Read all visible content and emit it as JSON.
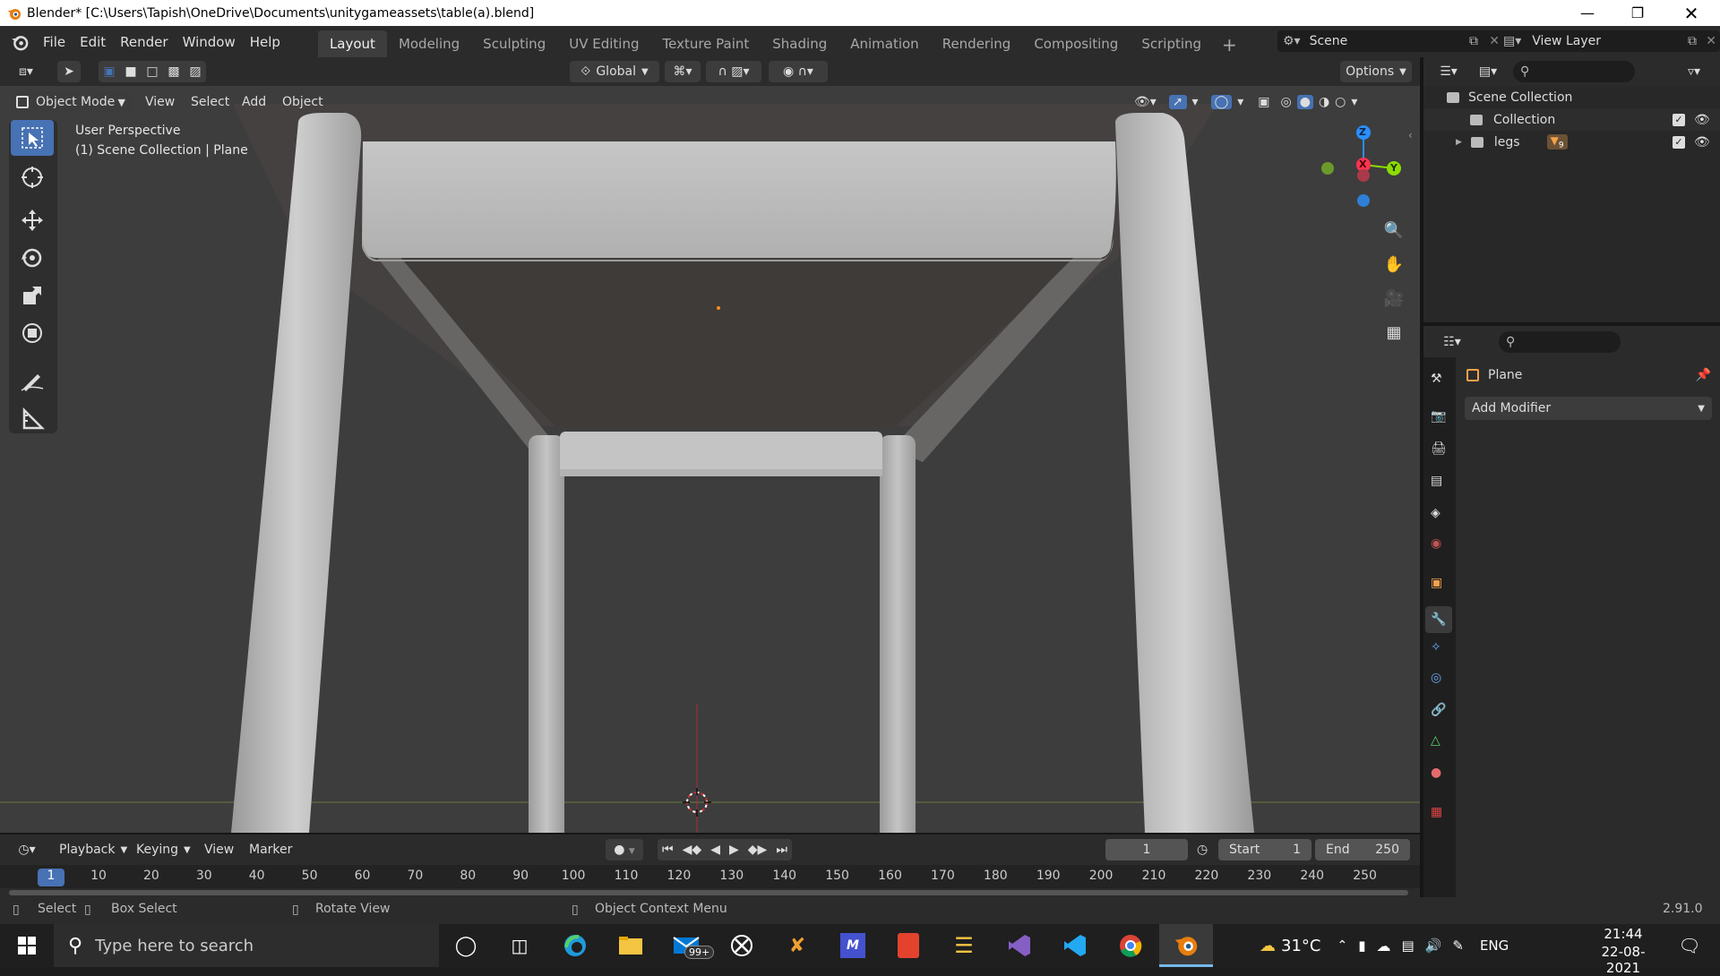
{
  "window": {
    "title": "Blender* [C:\\Users\\Tapish\\OneDrive\\Documents\\unitygameassets\\table(a).blend]"
  },
  "menu": [
    "File",
    "Edit",
    "Render",
    "Window",
    "Help"
  ],
  "workspaces": [
    "Layout",
    "Modeling",
    "Sculpting",
    "UV Editing",
    "Texture Paint",
    "Shading",
    "Animation",
    "Rendering",
    "Compositing",
    "Scripting"
  ],
  "active_workspace": "Layout",
  "scene": {
    "name": "Scene",
    "view_layer": "View Layer"
  },
  "viewport": {
    "transform_orientation": "Global",
    "options_label": "Options",
    "mode": "Object Mode",
    "header_menus": [
      "View",
      "Select",
      "Add",
      "Object"
    ],
    "info_line1": "User Perspective",
    "info_line2": "(1) Scene Collection | Plane",
    "gizmo": {
      "z": "Z",
      "x": "X",
      "y": "Y"
    }
  },
  "outliner": {
    "root": "Scene Collection",
    "items": [
      {
        "label": "Collection",
        "checked": true,
        "visible": true
      },
      {
        "label": "legs",
        "checked": true,
        "visible": true,
        "badge": "9"
      }
    ]
  },
  "properties": {
    "object_name": "Plane",
    "add_modifier": "Add Modifier"
  },
  "timeline": {
    "menus": [
      "Playback",
      "Keying",
      "View",
      "Marker"
    ],
    "current_frame": "1",
    "start_label": "Start",
    "start": "1",
    "end_label": "End",
    "end": "250",
    "ruler": [
      "1",
      "10",
      "20",
      "30",
      "40",
      "50",
      "60",
      "70",
      "80",
      "90",
      "100",
      "110",
      "120",
      "130",
      "140",
      "150",
      "160",
      "170",
      "180",
      "190",
      "200",
      "210",
      "220",
      "230",
      "240",
      "250"
    ]
  },
  "statusbar": {
    "select": "Select",
    "box_select": "Box Select",
    "rotate_view": "Rotate View",
    "context_menu": "Object Context Menu",
    "version": "2.91.0"
  },
  "taskbar": {
    "search_placeholder": "Type here to search",
    "mail_badge": "99+",
    "temperature": "31°C",
    "language": "ENG",
    "time": "21:44",
    "date": "22-08-2021"
  },
  "colors": {
    "accent_blue": "#4772b3",
    "viewport_bg": "#3d3d3d",
    "axis_x": "#ff3352",
    "axis_y": "#8bdc00",
    "axis_z": "#2890ff"
  }
}
